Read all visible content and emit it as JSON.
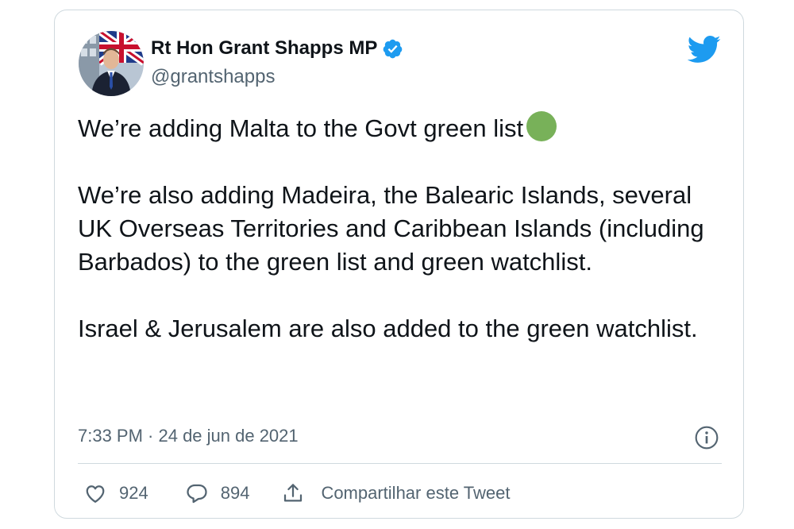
{
  "author": {
    "display_name": "Rt Hon Grant Shapps MP",
    "handle": "@grantshapps",
    "verified": true,
    "verified_badge_color": "#1d9bf0"
  },
  "brand": {
    "logo_icon": "twitter-bird-icon",
    "logo_color": "#1d9bf0"
  },
  "tweet": {
    "line1": "We’re adding Malta to the Govt green list",
    "emoji": "green-circle",
    "emoji_color": "#78b159",
    "paragraph2": "We’re also adding Madeira, the Balearic Islands, several UK Overseas Territories and Caribbean Islands (including Barbados) to the green list and green watchlist.",
    "paragraph3": "Israel & Jerusalem are also added to the green watchlist."
  },
  "meta": {
    "timestamp": "7:33 PM · 24 de jun de 2021",
    "info_icon": "info-icon"
  },
  "actions": {
    "like_count": "924",
    "reply_count": "894",
    "share_label": "Compartilhar este Tweet"
  },
  "colors": {
    "text_primary": "#0f1419",
    "text_secondary": "#536471",
    "border": "#cfd9de"
  }
}
